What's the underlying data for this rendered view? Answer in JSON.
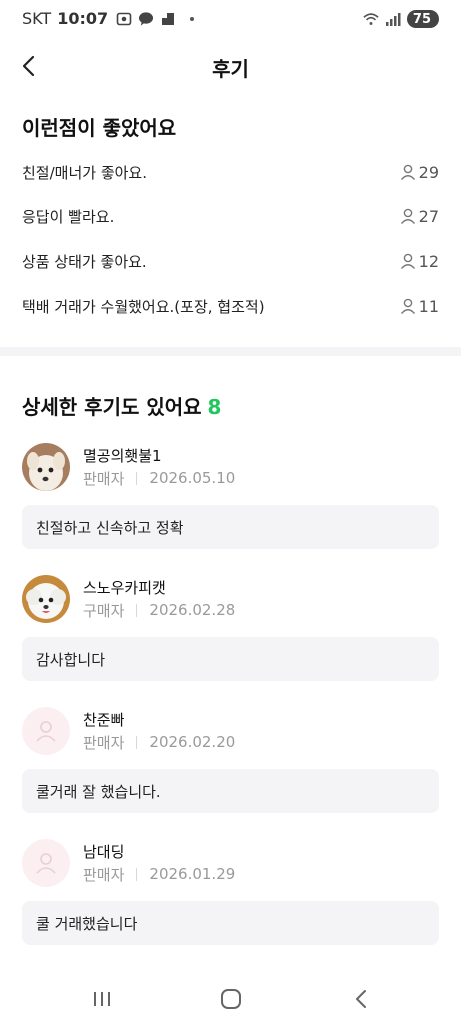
{
  "status_bar": {
    "carrier": "SKT",
    "time": "10:07",
    "battery": "75"
  },
  "header": {
    "title": "후기"
  },
  "good_points": {
    "title": "이런점이 좋았어요",
    "items": [
      {
        "label": "친절/매너가 좋아요.",
        "count": "29"
      },
      {
        "label": "응답이 빨라요.",
        "count": "27"
      },
      {
        "label": "상품 상태가 좋아요.",
        "count": "12"
      },
      {
        "label": "택배 거래가 수월했어요.(포장, 협조적)",
        "count": "11"
      }
    ]
  },
  "detailed_reviews": {
    "title": "상세한 후기도 있어요",
    "count": "8",
    "accent_color": "#22c55e",
    "items": [
      {
        "name": "멸공의횃불1",
        "role": "판매자",
        "date": "2026.05.10",
        "text": "친절하고 신속하고 정확"
      },
      {
        "name": "스노우카피캣",
        "role": "구매자",
        "date": "2026.02.28",
        "text": "감사합니다"
      },
      {
        "name": "찬준빠",
        "role": "판매자",
        "date": "2026.02.20",
        "text": "쿨거래 잘 했습니다."
      },
      {
        "name": "남대딩",
        "role": "판매자",
        "date": "2026.01.29",
        "text": "쿨 거래했습니다"
      }
    ]
  },
  "icons": {
    "back": "chevron-left-icon",
    "person": "person-icon",
    "nav_recent": "recent-apps-icon",
    "nav_home": "home-icon",
    "nav_back": "nav-back-icon"
  }
}
